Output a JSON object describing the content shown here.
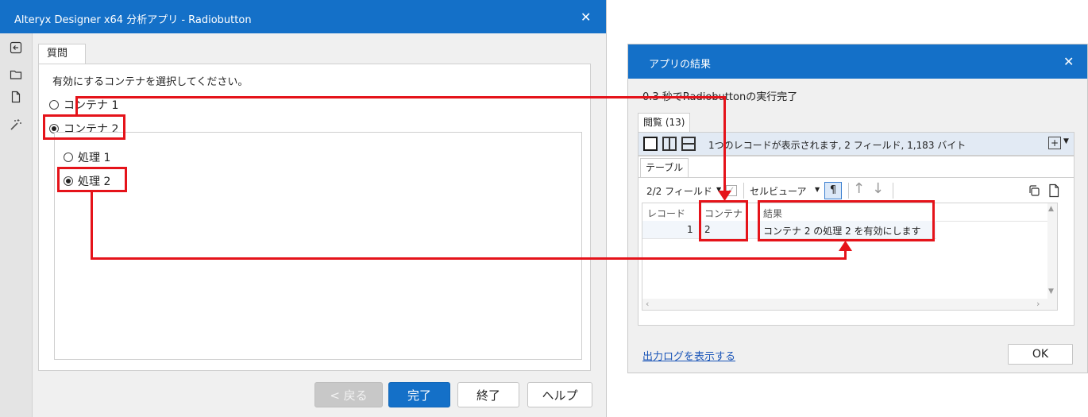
{
  "app_window": {
    "title": "Alteryx Designer x64 分析アプリ - Radiobutton",
    "close_glyph": "✕",
    "tab_label": "質問",
    "prompt": "有効にするコンテナを選択してください。",
    "options": [
      {
        "label": "コンテナ 1",
        "selected": false
      },
      {
        "label": "コンテナ 2",
        "selected": true
      }
    ],
    "sub_options": [
      {
        "label": "処理 1",
        "selected": false
      },
      {
        "label": "処理 2",
        "selected": true
      }
    ],
    "buttons": {
      "back": "< 戻る",
      "finish": "完了",
      "exit": "終了",
      "help": "ヘルプ"
    }
  },
  "result_window": {
    "title": "アプリの結果",
    "close_glyph": "✕",
    "status": "0.3 秒でRadiobuttonの実行完了",
    "browse_tab": "閲覧 (13)",
    "records_info": "1つのレコードが表示されます, 2 フィールド, 1,183 バイト",
    "table_tab": "テーブル",
    "fields_count": "2/2 フィールド",
    "cell_viewer": "セルビューア",
    "pilcrow": "¶",
    "columns": [
      "レコード",
      "コンテナ",
      "結果"
    ],
    "rows": [
      {
        "record": "1",
        "container": "2",
        "result": "コンテナ 2 の処理 2 を有効にします"
      }
    ],
    "log_link": "出力ログを表示する",
    "ok": "OK"
  },
  "colors": {
    "accent": "#1470c8",
    "annotation": "#e5131a"
  }
}
